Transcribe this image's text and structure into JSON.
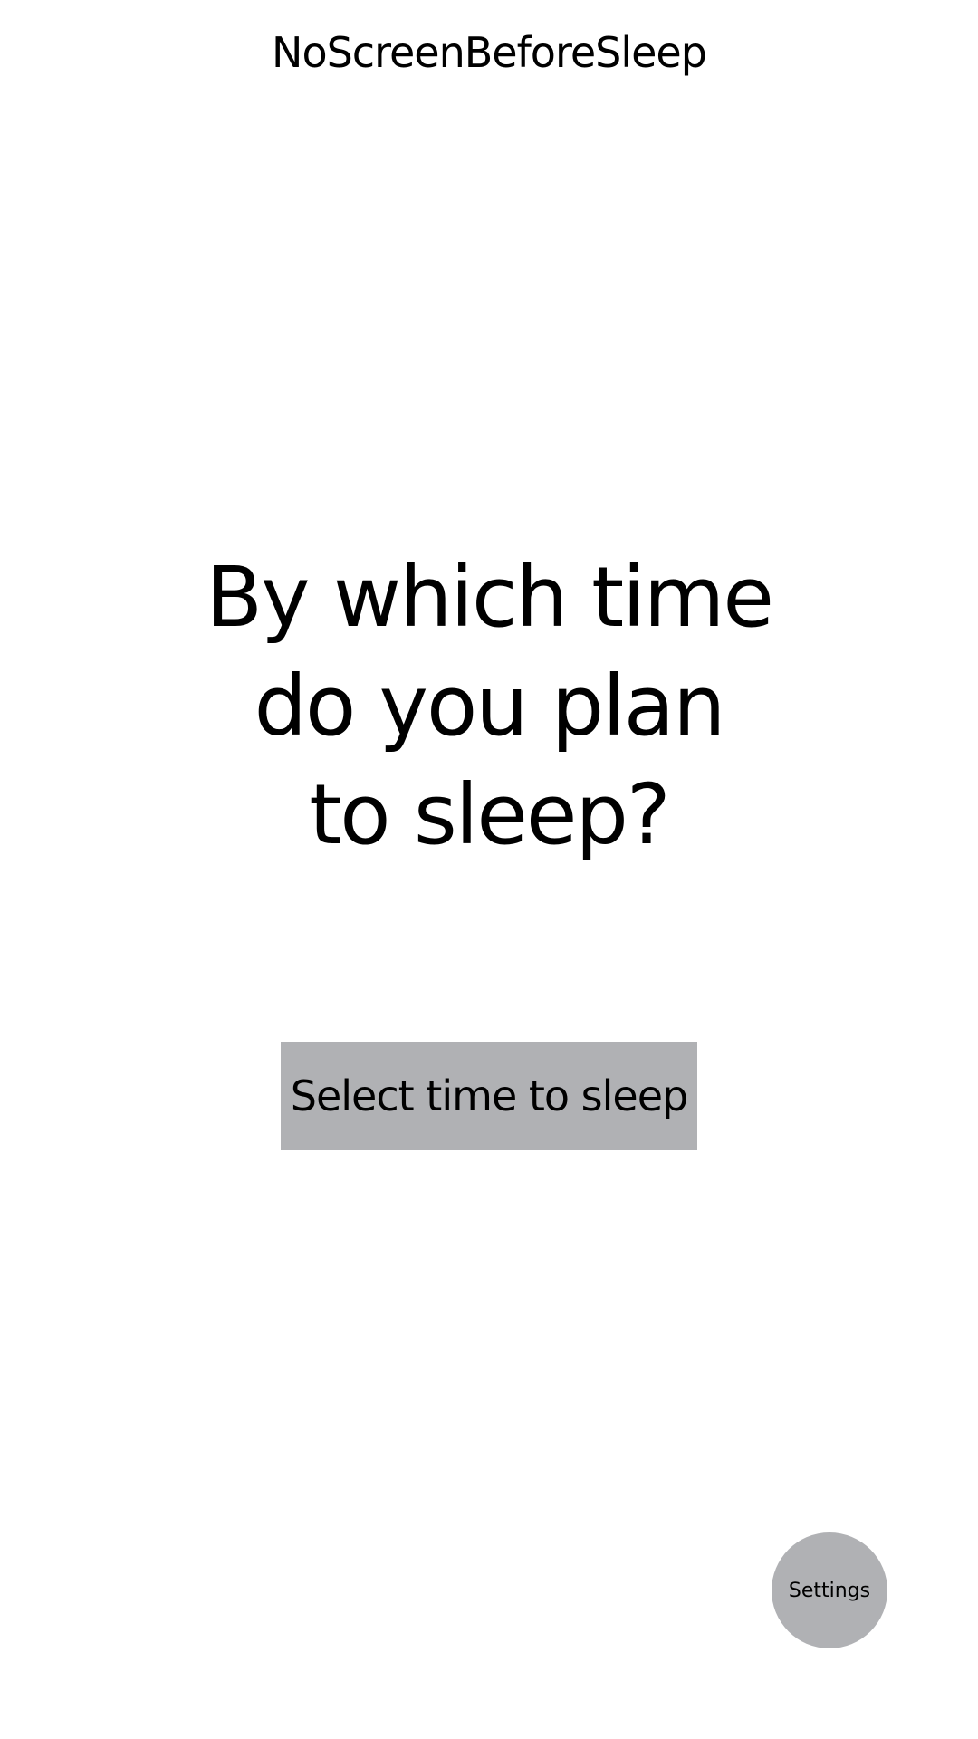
{
  "app": {
    "title": "NoScreenBeforeSleep"
  },
  "main": {
    "question_lines": [
      "By which time",
      "do you plan",
      "to sleep?"
    ],
    "select_button_label": "Select time to sleep"
  },
  "fab": {
    "settings_label": "Settings"
  },
  "colors": {
    "background": "#ffffff",
    "text": "#000000",
    "button_bg": "#b0b1b4"
  }
}
